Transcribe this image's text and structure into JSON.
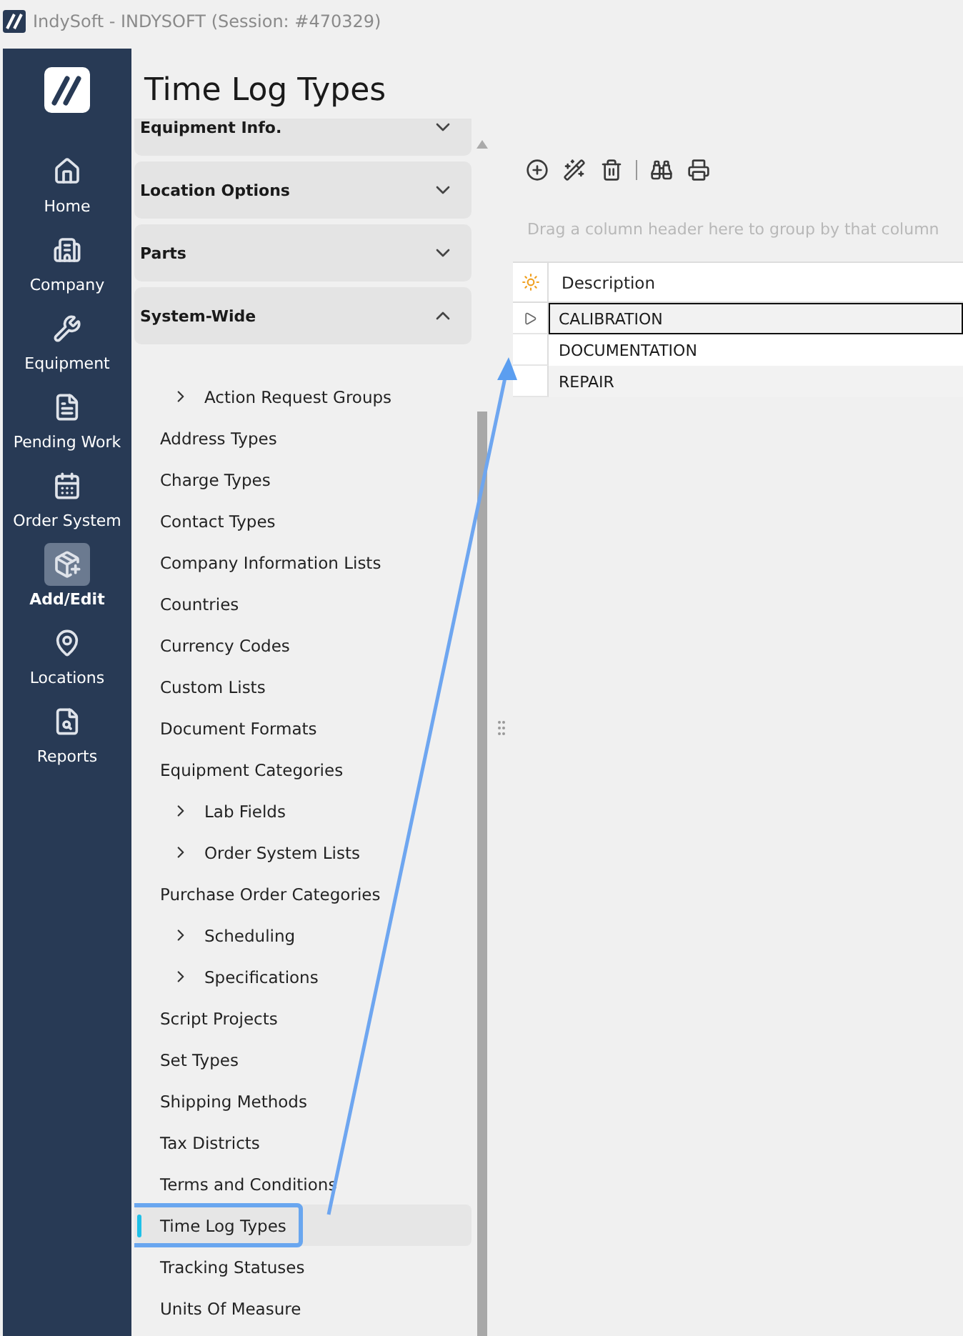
{
  "window": {
    "title": "IndySoft - INDYSOFT (Session: #470329)"
  },
  "nav": [
    {
      "label": "Home",
      "selected": false
    },
    {
      "label": "Company",
      "selected": false
    },
    {
      "label": "Equipment",
      "selected": false
    },
    {
      "label": "Pending Work",
      "selected": false
    },
    {
      "label": "Order System",
      "selected": false
    },
    {
      "label": "Add/Edit",
      "selected": true
    },
    {
      "label": "Locations",
      "selected": false
    },
    {
      "label": "Reports",
      "selected": false
    }
  ],
  "page_title": "Time Log Types",
  "sections": [
    {
      "label": "Equipment Info.",
      "expanded": false
    },
    {
      "label": "Location Options",
      "expanded": false
    },
    {
      "label": "Parts",
      "expanded": false
    },
    {
      "label": "System-Wide",
      "expanded": true
    }
  ],
  "items": [
    {
      "label": "Action Request Groups",
      "kind": "group",
      "selected": false
    },
    {
      "label": "Address Types",
      "kind": "leaf",
      "selected": false
    },
    {
      "label": "Charge Types",
      "kind": "leaf",
      "selected": false
    },
    {
      "label": "Contact Types",
      "kind": "leaf",
      "selected": false
    },
    {
      "label": "Company Information Lists",
      "kind": "leaf",
      "selected": false
    },
    {
      "label": "Countries",
      "kind": "leaf",
      "selected": false
    },
    {
      "label": "Currency Codes",
      "kind": "leaf",
      "selected": false
    },
    {
      "label": "Custom Lists",
      "kind": "leaf",
      "selected": false
    },
    {
      "label": "Document Formats",
      "kind": "leaf",
      "selected": false
    },
    {
      "label": "Equipment Categories",
      "kind": "leaf",
      "selected": false
    },
    {
      "label": "Lab Fields",
      "kind": "group",
      "selected": false
    },
    {
      "label": "Order System Lists",
      "kind": "group",
      "selected": false
    },
    {
      "label": "Purchase Order Categories",
      "kind": "leaf",
      "selected": false
    },
    {
      "label": "Scheduling",
      "kind": "group",
      "selected": false
    },
    {
      "label": "Specifications",
      "kind": "group",
      "selected": false
    },
    {
      "label": "Script Projects",
      "kind": "leaf",
      "selected": false
    },
    {
      "label": "Set Types",
      "kind": "leaf",
      "selected": false
    },
    {
      "label": "Shipping Methods",
      "kind": "leaf",
      "selected": false
    },
    {
      "label": "Tax Districts",
      "kind": "leaf",
      "selected": false
    },
    {
      "label": "Terms and Conditions",
      "kind": "leaf",
      "selected": false
    },
    {
      "label": "Time Log Types",
      "kind": "leaf",
      "selected": true
    },
    {
      "label": "Tracking Statuses",
      "kind": "leaf",
      "selected": false
    },
    {
      "label": "Units Of Measure",
      "kind": "leaf",
      "selected": false
    }
  ],
  "callout": {
    "kind": "arrow"
  },
  "group_hint": "Drag a column header here to group by that column",
  "table": {
    "columns": [
      "Description"
    ],
    "rows": [
      {
        "cells": [
          "CALIBRATION"
        ],
        "selected": true
      },
      {
        "cells": [
          "DOCUMENTATION"
        ],
        "selected": false
      },
      {
        "cells": [
          "REPAIR"
        ],
        "selected": false
      }
    ]
  }
}
